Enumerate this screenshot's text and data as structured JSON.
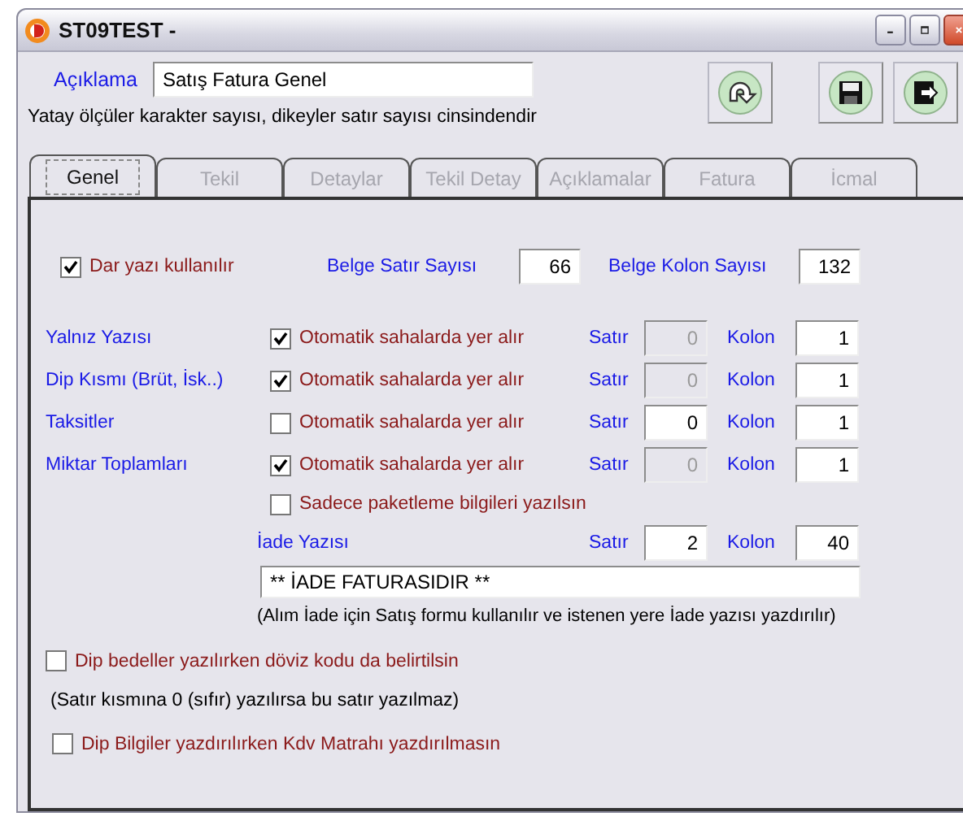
{
  "window": {
    "title": "ST09TEST -"
  },
  "header": {
    "description_label": "Açıklama",
    "description_value": "Satış Fatura Genel",
    "note": "Yatay ölçüler karakter sayısı, dikeyler satır sayısı cinsindendir"
  },
  "toolbar": [
    {
      "kind": "refresh"
    },
    {
      "kind": "save"
    },
    {
      "kind": "exit"
    }
  ],
  "tabs": [
    {
      "label": "Genel",
      "selected": true
    },
    {
      "label": "Tekil",
      "selected": false
    },
    {
      "label": "Detaylar",
      "selected": false
    },
    {
      "label": "Tekil Detay",
      "selected": false
    },
    {
      "label": "Açıklamalar",
      "selected": false
    },
    {
      "label": "Fatura",
      "selected": false
    },
    {
      "label": "İcmal",
      "selected": false
    }
  ],
  "narrow_font": {
    "label": "Dar yazı kullanılır",
    "checked": true
  },
  "document_rows": {
    "label": "Belge Satır Sayısı",
    "value": "66"
  },
  "document_columns": {
    "label": "Belge Kolon Sayısı",
    "value": "132"
  },
  "sections": [
    {
      "label": "Yalnız Yazısı",
      "auto": {
        "label": "Otomatik sahalarda yer alır",
        "checked": true
      },
      "row_label": "Satır",
      "row": {
        "value": "0",
        "disabled": true
      },
      "column_label": "Kolon",
      "column": "1"
    },
    {
      "label": "Dip Kısmı (Brüt, İsk..)",
      "auto": {
        "label": "Otomatik sahalarda yer alır",
        "checked": true
      },
      "row_label": "Satır",
      "row": {
        "value": "0",
        "disabled": true
      },
      "column_label": "Kolon",
      "column": "1"
    },
    {
      "label": "Taksitler",
      "auto": {
        "label": "Otomatik sahalarda yer alır",
        "checked": false
      },
      "row_label": "Satır",
      "row": {
        "value": "0",
        "disabled": false
      },
      "column_label": "Kolon",
      "column": "1"
    },
    {
      "label": "Miktar Toplamları",
      "auto": {
        "label": "Otomatik sahalarda yer alır",
        "checked": true
      },
      "row_label": "Satır",
      "row": {
        "value": "0",
        "disabled": true
      },
      "column_label": "Kolon",
      "column": "1"
    }
  ],
  "packaging_only": {
    "label": "Sadece paketleme bilgileri yazılsın",
    "checked": false
  },
  "return_text": {
    "label": "İade Yazısı",
    "row_label": "Satır",
    "row": "2",
    "column_label": "Kolon",
    "column": "40",
    "value": "** İADE FATURASIDIR **",
    "note": "(Alım İade için Satış formu kullanılır ve istenen yere İade yazısı yazdırılır)"
  },
  "currency_code": {
    "label": "Dip bedeller yazılırken döviz kodu da belirtilsin",
    "checked": false
  },
  "zero_note": "(Satır kısmına 0 (sıfır) yazılırsa bu satır yazılmaz)",
  "vat_base": {
    "label": "Dip Bilgiler yazdırılırken Kdv Matrahı yazdırılmasın",
    "checked": false
  }
}
